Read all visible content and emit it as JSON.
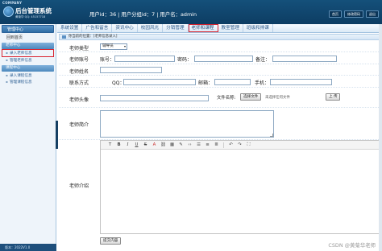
{
  "header": {
    "company_tag": "COMPANY",
    "system_title": "后台管理系统",
    "system_sub": "黄菊华 QQ: 45157718",
    "user_info": "用户id：36 | 用户分组id：7 | 用户名：admin",
    "buttons": [
      "首页",
      "修改密码",
      "退出"
    ]
  },
  "sidebar": {
    "head": "管理中心",
    "top_link": "回到首页",
    "groups": [
      {
        "title": "老师中心",
        "items": [
          "录入老师信息",
          "管理老师信息"
        ]
      },
      {
        "title": "课程中心",
        "items": [
          "录入课程信息",
          "管理课程信息"
        ]
      }
    ],
    "footer": "版本：2022V1.0"
  },
  "nav": {
    "tabs": [
      "系统设置",
      "广告和留言",
      "资讯中心",
      "校园风光",
      "分销管理",
      "老师和课程",
      "教室管理",
      "班级和排课"
    ],
    "active_index": 5
  },
  "breadcrumb": "你当前的位置：[老师信息录入]",
  "form": {
    "type_label": "老师类型",
    "type_value": "辅导员",
    "account_label": "老师账号",
    "account_field": "账号：",
    "password_field": "密码：",
    "note_field": "备注：",
    "name_label": "老师姓名",
    "contact_label": "联系方式",
    "qq_field": "QQ：",
    "email_field": "邮箱：",
    "phone_field": "手机：",
    "avatar_label": "老师头像",
    "file_name_label": "文件名称:",
    "choose_file_button": "选择文件",
    "no_file_text": "未选择任何文件",
    "upload_button": "上 传",
    "intro_label": "老师简介",
    "detail_label": "老师介绍",
    "submit_button": "提交内容"
  },
  "editor_tools": [
    "T",
    "B",
    "I",
    "U",
    "S",
    "A",
    "link",
    "table",
    "pen",
    "code",
    "ul",
    "ol",
    "align",
    "undo",
    "redo",
    "fullscreen"
  ],
  "watermark": "CSDN @黄菊华老师"
}
